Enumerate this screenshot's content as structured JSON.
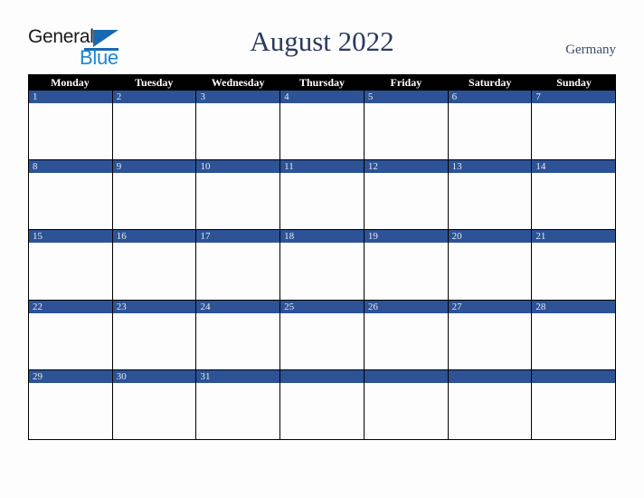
{
  "brand": {
    "name_part1": "General",
    "name_part2": "Blue",
    "triangle_icon": "triangle-icon",
    "accent_dark": "#1769b0",
    "accent_light": "#1b86d8"
  },
  "header": {
    "title": "August 2022",
    "country": "Germany",
    "title_color": "#2b3a5e"
  },
  "calendar": {
    "weekdays": [
      "Monday",
      "Tuesday",
      "Wednesday",
      "Thursday",
      "Friday",
      "Saturday",
      "Sunday"
    ],
    "header_bg": "#000000",
    "day_bar_color": "#2d5396",
    "day_text_color": "#e6e9f0",
    "weeks": [
      [
        {
          "num": "1"
        },
        {
          "num": "2"
        },
        {
          "num": "3"
        },
        {
          "num": "4"
        },
        {
          "num": "5"
        },
        {
          "num": "6"
        },
        {
          "num": "7"
        }
      ],
      [
        {
          "num": "8"
        },
        {
          "num": "9"
        },
        {
          "num": "10"
        },
        {
          "num": "11"
        },
        {
          "num": "12"
        },
        {
          "num": "13"
        },
        {
          "num": "14"
        }
      ],
      [
        {
          "num": "15"
        },
        {
          "num": "16"
        },
        {
          "num": "17"
        },
        {
          "num": "18"
        },
        {
          "num": "19"
        },
        {
          "num": "20"
        },
        {
          "num": "21"
        }
      ],
      [
        {
          "num": "22"
        },
        {
          "num": "23"
        },
        {
          "num": "24"
        },
        {
          "num": "25"
        },
        {
          "num": "26"
        },
        {
          "num": "27"
        },
        {
          "num": "28"
        }
      ],
      [
        {
          "num": "29"
        },
        {
          "num": "30"
        },
        {
          "num": "31"
        },
        {
          "num": ""
        },
        {
          "num": ""
        },
        {
          "num": ""
        },
        {
          "num": ""
        }
      ]
    ]
  }
}
